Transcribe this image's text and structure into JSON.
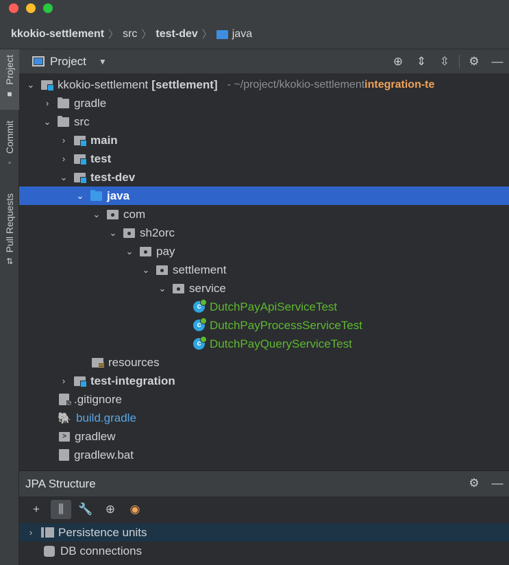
{
  "breadcrumbs": {
    "items": [
      "kkokio-settlement",
      "src",
      "test-dev",
      "java"
    ]
  },
  "stripe": {
    "tabs": [
      "Project",
      "Commit",
      "Pull Requests"
    ]
  },
  "project_panel": {
    "title": "Project",
    "tree": [
      {
        "label": "kkokio-settlement",
        "module": "[settlement]",
        "path": "- ~/project/kkokio-settlement",
        "branch": "integration-te"
      },
      {
        "label": "gradle"
      },
      {
        "label": "src"
      },
      {
        "label": "main"
      },
      {
        "label": "test"
      },
      {
        "label": "test-dev"
      },
      {
        "label": "java"
      },
      {
        "label": "com"
      },
      {
        "label": "sh2orc"
      },
      {
        "label": "pay"
      },
      {
        "label": "settlement"
      },
      {
        "label": "service"
      },
      {
        "label": "DutchPayApiServiceTest"
      },
      {
        "label": "DutchPayProcessServiceTest"
      },
      {
        "label": "DutchPayQueryServiceTest"
      },
      {
        "label": "resources"
      },
      {
        "label": "test-integration"
      },
      {
        "label": ".gitignore"
      },
      {
        "label": "build.gradle"
      },
      {
        "label": "gradlew"
      },
      {
        "label": "gradlew.bat"
      }
    ]
  },
  "jpa_panel": {
    "title": "JPA Structure",
    "items": [
      {
        "label": "Persistence units"
      },
      {
        "label": "DB connections"
      }
    ]
  },
  "colors": {
    "selection": "#2f65ca",
    "test_green": "#5fb832",
    "branch_orange": "#f0a35a",
    "folder_blue": "#3d9ae8"
  }
}
